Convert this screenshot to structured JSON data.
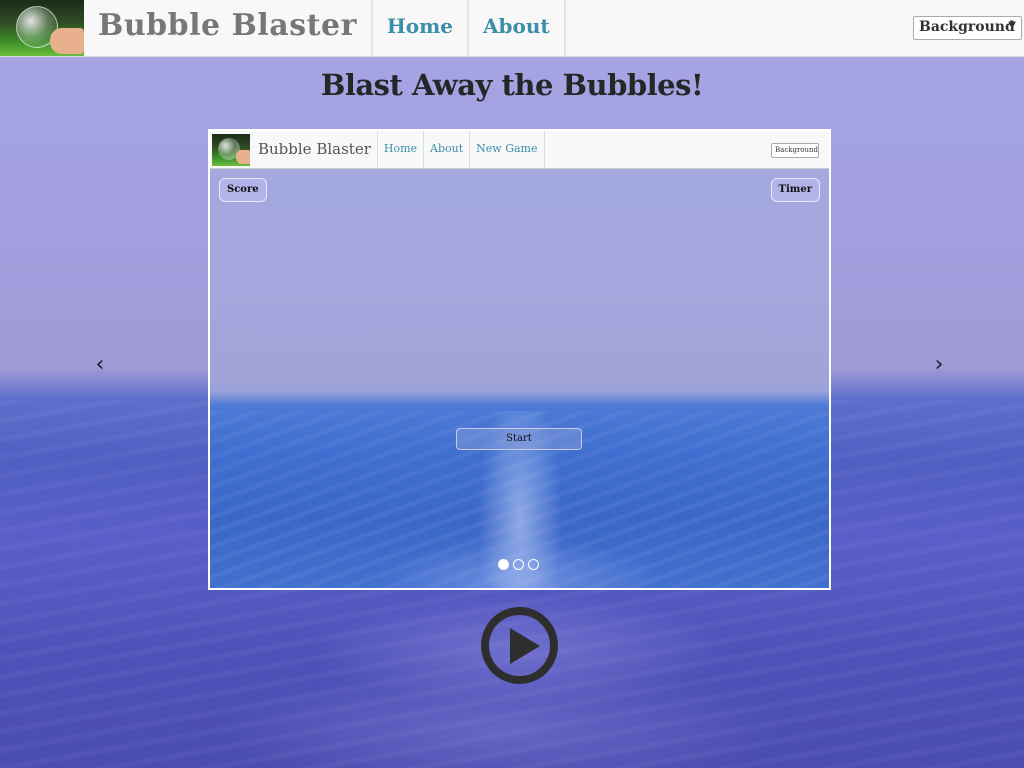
{
  "navbar": {
    "brand_title": "Bubble Blaster",
    "links": [
      {
        "label": "Home"
      },
      {
        "label": "About"
      }
    ],
    "background_select": {
      "selected": "Background"
    }
  },
  "page": {
    "heading": "Blast Away the Bubbles!"
  },
  "carousel": {
    "prev_icon": "chevron-left-icon",
    "next_icon": "chevron-right-icon",
    "slide": {
      "mini_nav": {
        "brand_title": "Bubble Blaster",
        "links": [
          {
            "label": "Home"
          },
          {
            "label": "About"
          },
          {
            "label": "New Game"
          }
        ],
        "background_select": {
          "selected": "Background"
        }
      },
      "score_label": "Score",
      "timer_label": "Timer",
      "start_label": "Start"
    },
    "indicators": {
      "count": 3,
      "active_index": 0
    }
  },
  "play_button": {
    "icon": "play-icon"
  },
  "colors": {
    "link": "#3b8fa8",
    "brand_text": "#777777",
    "heading_text": "#262626",
    "navbar_bg": "#f8f8f8",
    "play_icon": "#2e2e2e"
  }
}
